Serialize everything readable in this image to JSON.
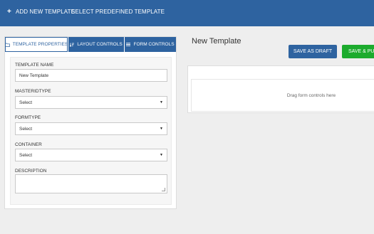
{
  "topbar": {
    "add_template": "ADD NEW TEMPLATE",
    "select_predefined": "SELECT PREDEFINED TEMPLATE"
  },
  "tabs": {
    "template_properties": "TEMPLATE PROPERTIES",
    "layout_controls": "LAYOUT CONTROLS",
    "form_controls": "FORM CONTROLS"
  },
  "form": {
    "template_name_label": "TEMPLATE NAME",
    "template_name_value": "New Template",
    "masteridtype_label": "MASTERIDTYPE",
    "masteridtype_value": "Select",
    "formtype_label": "FORMTYPE",
    "formtype_value": "Select",
    "container_label": "CONTAINER",
    "container_value": "Select",
    "description_label": "DESCRIPTION",
    "description_value": ""
  },
  "main": {
    "title": "New Template",
    "save_draft": "SAVE AS DRAFT",
    "save_publish": "SAVE & PUBLISH",
    "drop_hint": "Drag form controls here"
  },
  "colors": {
    "primary": "#2e63a0",
    "success": "#1cab2d",
    "background": "#eeeeee"
  }
}
